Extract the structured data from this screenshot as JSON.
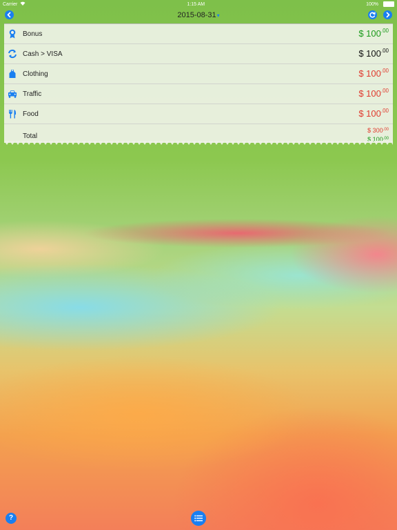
{
  "status_bar": {
    "carrier": "Carrier",
    "time": "1:15 AM",
    "battery": "100%"
  },
  "nav": {
    "date": "2015-08-31",
    "caret": "▾"
  },
  "rows": [
    {
      "label": "Bonus",
      "amount_main": "$ 100",
      "amount_cents": ".00",
      "color": "#1a9a1a",
      "icon": "award-icon"
    },
    {
      "label": "Cash > VISA",
      "amount_main": "$ 100",
      "amount_cents": ".00",
      "color": "#111111",
      "icon": "transfer-icon"
    },
    {
      "label": "Clothing",
      "amount_main": "$ 100",
      "amount_cents": ".00",
      "color": "#e03a2e",
      "icon": "clothing-icon"
    },
    {
      "label": "Traffic",
      "amount_main": "$ 100",
      "amount_cents": ".00",
      "color": "#e03a2e",
      "icon": "car-icon"
    },
    {
      "label": "Food",
      "amount_main": "$ 100",
      "amount_cents": ".00",
      "color": "#e03a2e",
      "icon": "fork-knife-icon"
    }
  ],
  "total": {
    "label": "Total",
    "expense_main": "$ 300",
    "expense_cents": ".00",
    "income_main": "$ 100",
    "income_cents": ".00"
  },
  "bottom": {
    "help_label": "?"
  },
  "colors": {
    "accent": "#1a7ff0",
    "income": "#1a9a1a",
    "expense": "#e03a2e"
  }
}
